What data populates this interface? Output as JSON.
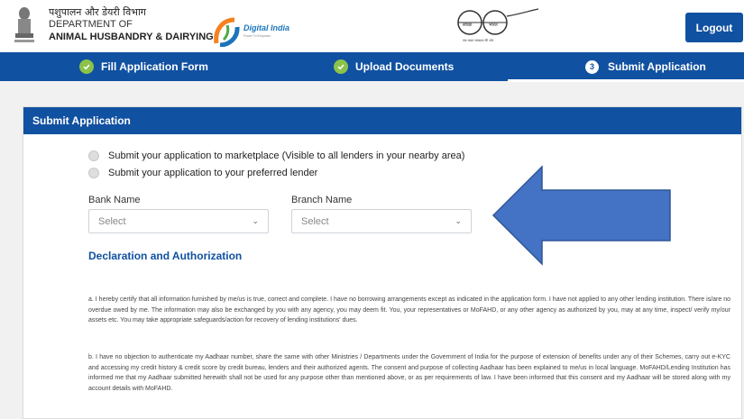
{
  "header": {
    "dept_hindi": "पशुपालन और डेयरी विभाग",
    "dept_line2": "DEPARTMENT OF",
    "dept_line3": "ANIMAL HUSBANDRY & DAIRYING",
    "digital_india": "Digital India",
    "digital_india_sub": "Power To Empower",
    "swachh_left": "स्वच्छ",
    "swachh_right": "भारत",
    "swachh_tagline": "एक कदम स्वच्छता की ओर",
    "logout_label": "Logout"
  },
  "steps": [
    {
      "label": "Fill Application Form",
      "status": "done"
    },
    {
      "label": "Upload Documents",
      "status": "done"
    },
    {
      "label": "Submit Application",
      "status": "active",
      "number": "3"
    }
  ],
  "card": {
    "title": "Submit Application",
    "options": [
      "Submit your application to marketplace (Visible to all lenders in your nearby area)",
      "Submit your application to your preferred lender"
    ],
    "bank_label": "Bank Name",
    "bank_value": "Select",
    "branch_label": "Branch Name",
    "branch_value": "Select",
    "declaration_title": "Declaration and Authorization",
    "para_a": "a. I hereby certify that all information furnished by me/us is true, correct and complete. I have no borrowing arrangements except as indicated in the application form. I have not applied to any other lending institution. There is/are no overdue owed by me. The information may also be exchanged by you with any agency, you may deem fit. You, your representatives or MoFAHD, or any other agency as authorized by you, may at any time, inspect/ verify my/our assets etc. You may take appropriate safeguards/action for recovery of lending institutions' dues.",
    "para_b": "b. I have no objection to authenticate my Aadhaar number, share the same with other Ministries / Departments under the Government of India for the purpose of extension of benefits under any of their Schemes, carry out e-KYC and accessing my credit history & credit score by credit bureau, lenders and their authorized agents. The consent and purpose of collecting Aadhaar has been explained to me/us in local language. MoFAHD/Lending Institution has informed me that my Aadhaar submitted herewith shall not be used for any purpose other than mentioned above, or as per requirements of law. I have been informed that this consent and my Aadhaar will be stored along with my account details with MoFAHD."
  },
  "colors": {
    "brand_blue": "#1151a1",
    "check_green": "#8bc34a",
    "arrow_blue": "#4472c4"
  },
  "icons": [
    "national-emblem-icon",
    "digital-india-logo",
    "swachh-bharat-logo",
    "check-icon",
    "chevron-down-icon",
    "arrow-left-annotation"
  ]
}
